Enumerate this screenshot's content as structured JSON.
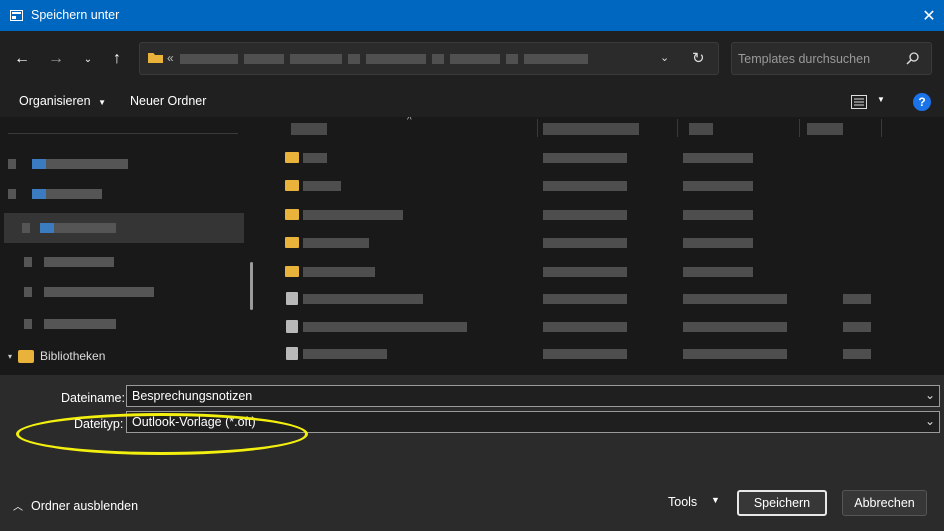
{
  "window": {
    "title": "Speichern unter",
    "title_icon": "save-dialog-icon",
    "close_icon": "close-icon"
  },
  "navigation": {
    "back_icon": "arrow-left-icon",
    "forward_icon": "arrow-right-icon",
    "recent_icon": "chevron-down-icon",
    "up_icon": "arrow-up-icon",
    "address_prefix": "«",
    "refresh_icon": "refresh-icon"
  },
  "search": {
    "placeholder": "Templates durchsuchen",
    "icon": "search-icon"
  },
  "toolbar": {
    "organize_label": "Organisieren",
    "new_folder_label": "Neuer Ordner",
    "help_label": "?"
  },
  "sidebar": {
    "library_label": "Bibliotheken"
  },
  "form": {
    "filename_label": "Dateiname:",
    "filename_value": "Besprechungsnotizen",
    "filetype_label": "Dateityp:",
    "filetype_value": "Outlook-Vorlage (*.oft)"
  },
  "footer": {
    "hide_folders_label": "Ordner ausblenden",
    "tools_label": "Tools",
    "save_label": "Speichern",
    "cancel_label": "Abbrechen"
  },
  "colors": {
    "accent": "#0067c0",
    "annotation": "#f3ef0f",
    "folder": "#e9b23a"
  }
}
